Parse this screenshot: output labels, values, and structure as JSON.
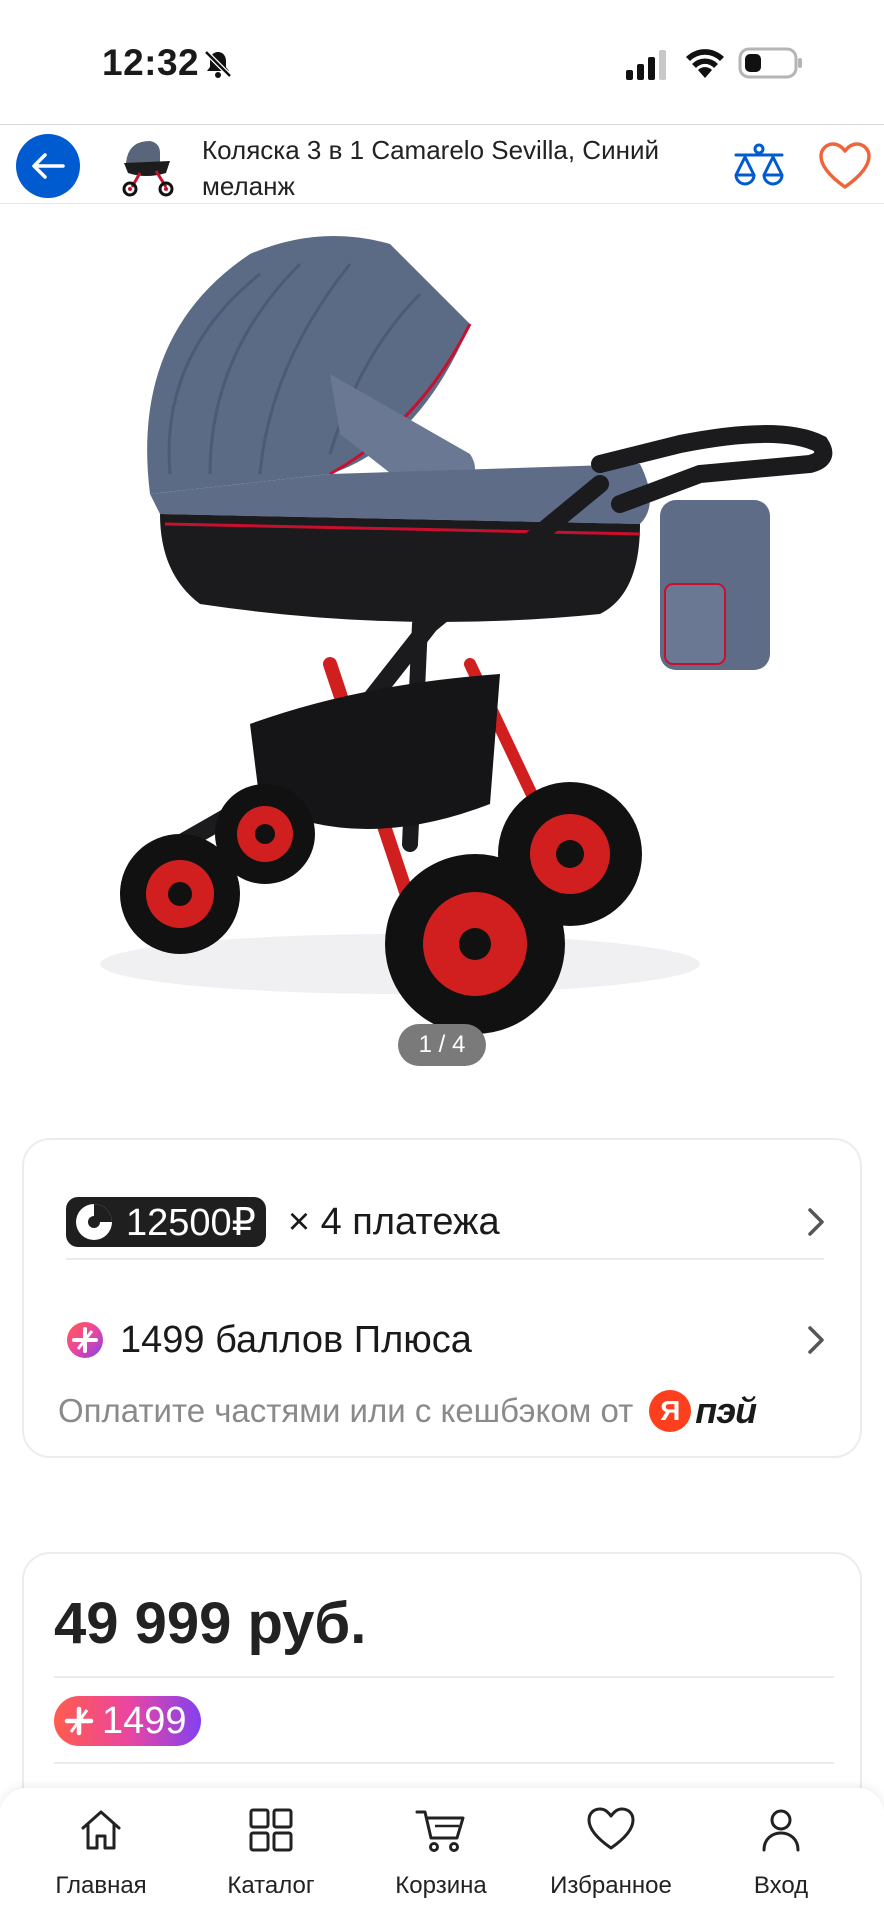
{
  "status_bar": {
    "time": "12:32"
  },
  "header": {
    "title": "Коляска 3 в 1 Camarelo Sevilla, Синий меланж",
    "accent_color": "#005bd1",
    "heart_color": "#f0643c"
  },
  "gallery": {
    "pager": "1 / 4"
  },
  "payment": {
    "split_amount": "12500₽",
    "split_suffix": "× 4 платежа",
    "plus_points": "1499 баллов Плюса",
    "footer_text": "Оплатите частями или с кешбэком от",
    "yapay_letter": "Я",
    "yapay_word": "пэй"
  },
  "price_card": {
    "price": "49 999 руб.",
    "plus_badge": "1499"
  },
  "bottom_nav": {
    "items": [
      {
        "label": "Главная",
        "icon": "home-icon"
      },
      {
        "label": "Каталог",
        "icon": "catalog-icon"
      },
      {
        "label": "Корзина",
        "icon": "cart-icon"
      },
      {
        "label": "Избранное",
        "icon": "heart-icon"
      },
      {
        "label": "Вход",
        "icon": "user-icon"
      }
    ]
  }
}
